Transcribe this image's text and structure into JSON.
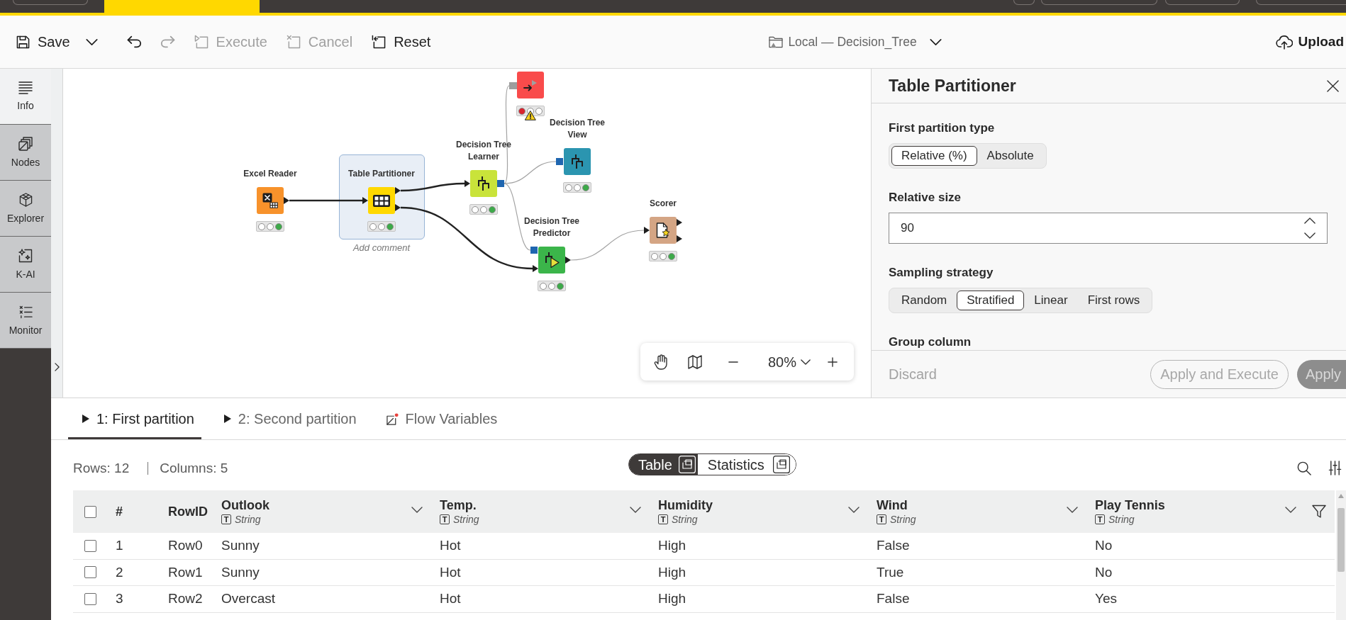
{
  "workflow_tabs": [
    {
      "selected": false
    },
    {
      "selected": true
    }
  ],
  "toolbar": [
    {
      "kind": "save",
      "label": "Save",
      "disabled": false
    },
    {
      "kind": "menu",
      "disabled": false
    },
    {
      "kind": "undo",
      "disabled": false
    },
    {
      "kind": "redo",
      "disabled": true
    },
    {
      "kind": "execute",
      "label": "Execute",
      "disabled": true
    },
    {
      "kind": "cancel",
      "label": "Cancel",
      "disabled": true
    },
    {
      "kind": "reset",
      "label": "Reset",
      "disabled": false
    }
  ],
  "location": {
    "label": "Local — Decision_Tree"
  },
  "upload_button": {
    "label": "Upload"
  },
  "sidebar": {
    "items": [
      {
        "kind": "info",
        "label": "Info",
        "selected": true
      },
      {
        "kind": "nodes",
        "label": "Nodes",
        "selected": false
      },
      {
        "kind": "explorer",
        "label": "Explorer",
        "selected": false
      },
      {
        "kind": "ai",
        "label": "K-AI",
        "selected": false
      },
      {
        "kind": "monitor",
        "label": "Monitor",
        "selected": false
      }
    ]
  },
  "canvas": {
    "nodes": [
      {
        "label": "Excel Reader",
        "kind": "source",
        "color": "#f7922b",
        "executed": true,
        "failed": false,
        "warning": false,
        "selected": false
      },
      {
        "label": "Table Partitioner",
        "kind": "manipulator",
        "color": "#ffd800",
        "executed": true,
        "failed": false,
        "warning": false,
        "selected": true,
        "comment_placeholder": "Add comment"
      },
      {
        "label": "Decision Tree Learner",
        "kind": "learner",
        "color": "#c9e33a",
        "executed": true,
        "failed": false,
        "warning": false,
        "selected": false
      },
      {
        "kind": "sink",
        "color": "#f94b4b",
        "executed": false,
        "failed": true,
        "warning": true,
        "selected": false
      },
      {
        "label": "Decision Tree View",
        "kind": "visualizer",
        "color": "#2b95b0",
        "executed": true,
        "failed": false,
        "warning": false,
        "selected": false
      },
      {
        "label": "Decision Tree Predictor",
        "kind": "predictor",
        "color": "#3bb54a",
        "executed": true,
        "failed": false,
        "warning": false,
        "selected": false
      },
      {
        "label": "Scorer",
        "kind": "other",
        "color": "#d4a584",
        "executed": true,
        "failed": false,
        "warning": false,
        "selected": false
      }
    ],
    "connections": [
      {
        "highlighted": true
      },
      {
        "highlighted": true
      },
      {
        "highlighted": true
      },
      {
        "highlighted": false
      },
      {
        "highlighted": false
      },
      {
        "highlighted": false
      },
      {
        "highlighted": false
      }
    ],
    "zoom": {
      "value": "80%"
    }
  },
  "node_dialog": {
    "title": "Table Partitioner",
    "settings": [
      {
        "kind": "choice",
        "label": "First partition type",
        "options": [
          {
            "label": "Relative (%)",
            "selected": true
          },
          {
            "label": "Absolute",
            "selected": false
          }
        ]
      },
      {
        "kind": "number",
        "label": "Relative size",
        "value": "90"
      },
      {
        "kind": "choice",
        "label": "Sampling strategy",
        "options": [
          {
            "label": "Random",
            "selected": false
          },
          {
            "label": "Stratified",
            "selected": true
          },
          {
            "label": "Linear",
            "selected": false
          },
          {
            "label": "First rows",
            "selected": false
          }
        ]
      },
      {
        "kind": "heading",
        "label": "Group column"
      }
    ],
    "buttons": [
      {
        "kind": "text",
        "label": "Discard",
        "disabled": true
      },
      {
        "kind": "outline",
        "label": "Apply and Execute",
        "disabled": true
      },
      {
        "kind": "filled",
        "label": "Apply",
        "disabled": true
      }
    ]
  },
  "output_tabs": [
    {
      "kind": "table",
      "label": "1: First partition",
      "selected": true
    },
    {
      "kind": "table",
      "label": "2: Second partition",
      "selected": false
    },
    {
      "kind": "variables",
      "label": "Flow Variables",
      "selected": false
    }
  ],
  "table_view": {
    "rows_count": "Rows: 12",
    "columns_count": "Columns: 5",
    "view_modes": [
      {
        "label": "Table",
        "selected": true
      },
      {
        "label": "Statistics",
        "selected": false
      }
    ],
    "table": {
      "all_checked": false,
      "number_header": "#",
      "row_id_header": "RowID",
      "columns": [
        {
          "name": "Outlook",
          "type_symbol": "T",
          "type": "String"
        },
        {
          "name": "Temp.",
          "type_symbol": "T",
          "type": "String"
        },
        {
          "name": "Humidity",
          "type_symbol": "T",
          "type": "String"
        },
        {
          "name": "Wind",
          "type_symbol": "T",
          "type": "String"
        },
        {
          "name": "Play Tennis",
          "type_symbol": "T",
          "type": "String"
        }
      ],
      "rows": [
        {
          "number": "1",
          "row_id": "Row0",
          "checked": false,
          "cells": [
            "Sunny",
            "Hot",
            "High",
            "False",
            "No"
          ]
        },
        {
          "number": "2",
          "row_id": "Row1",
          "checked": false,
          "cells": [
            "Sunny",
            "Hot",
            "High",
            "True",
            "No"
          ]
        },
        {
          "number": "3",
          "row_id": "Row2",
          "checked": false,
          "cells": [
            "Overcast",
            "Hot",
            "High",
            "False",
            "Yes"
          ]
        }
      ]
    }
  }
}
